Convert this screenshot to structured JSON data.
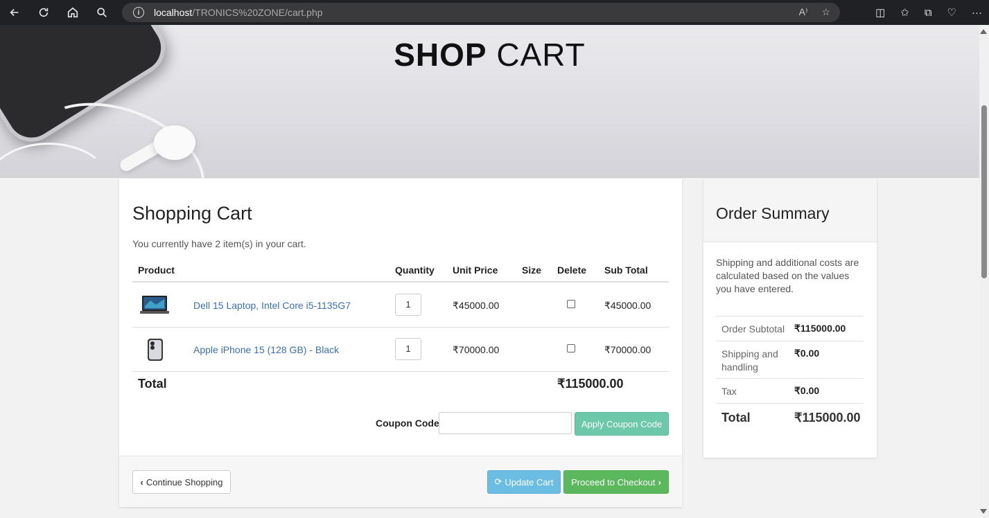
{
  "browser": {
    "url_host": "localhost",
    "url_path": "/TRONICS%20ZONE/cart.php",
    "read_aloud": "A⁾"
  },
  "hero": {
    "title_bold": "SHOP",
    "title_light": "CART"
  },
  "cart": {
    "title": "Shopping Cart",
    "subtitle": "You currently have 2 item(s) in your cart.",
    "headers": {
      "product": "Product",
      "quantity": "Quantity",
      "unit_price": "Unit Price",
      "size": "Size",
      "delete": "Delete",
      "subtotal": "Sub Total"
    },
    "items": [
      {
        "name": "Dell 15 Laptop, Intel Core i5-1135G7",
        "qty": "1",
        "unit_price": "₹45000.00",
        "size": "",
        "subtotal": "₹45000.00"
      },
      {
        "name": "Apple iPhone 15 (128 GB) - Black",
        "qty": "1",
        "unit_price": "₹70000.00",
        "size": "",
        "subtotal": "₹70000.00"
      }
    ],
    "total_label": "Total",
    "total_value": "₹115000.00",
    "coupon_label": "Coupon Code :",
    "coupon_value": "",
    "apply_coupon": "Apply Coupon Code",
    "continue": "Continue Shopping",
    "update": "Update Cart",
    "checkout": "Proceed to Checkout"
  },
  "summary": {
    "title": "Order Summary",
    "note": "Shipping and additional costs are calculated based on the values you have entered.",
    "rows": [
      {
        "label": "Order Subtotal",
        "value": "₹115000.00"
      },
      {
        "label": "Shipping and handling",
        "value": "₹0.00"
      },
      {
        "label": "Tax",
        "value": "₹0.00"
      }
    ],
    "total_label": "Total",
    "total_value": "₹115000.00"
  },
  "colors": {
    "link": "#3a6fb0",
    "coupon_button": "#6cc8a8",
    "update_button": "#6bbde3",
    "checkout_button": "#5cb85c"
  }
}
